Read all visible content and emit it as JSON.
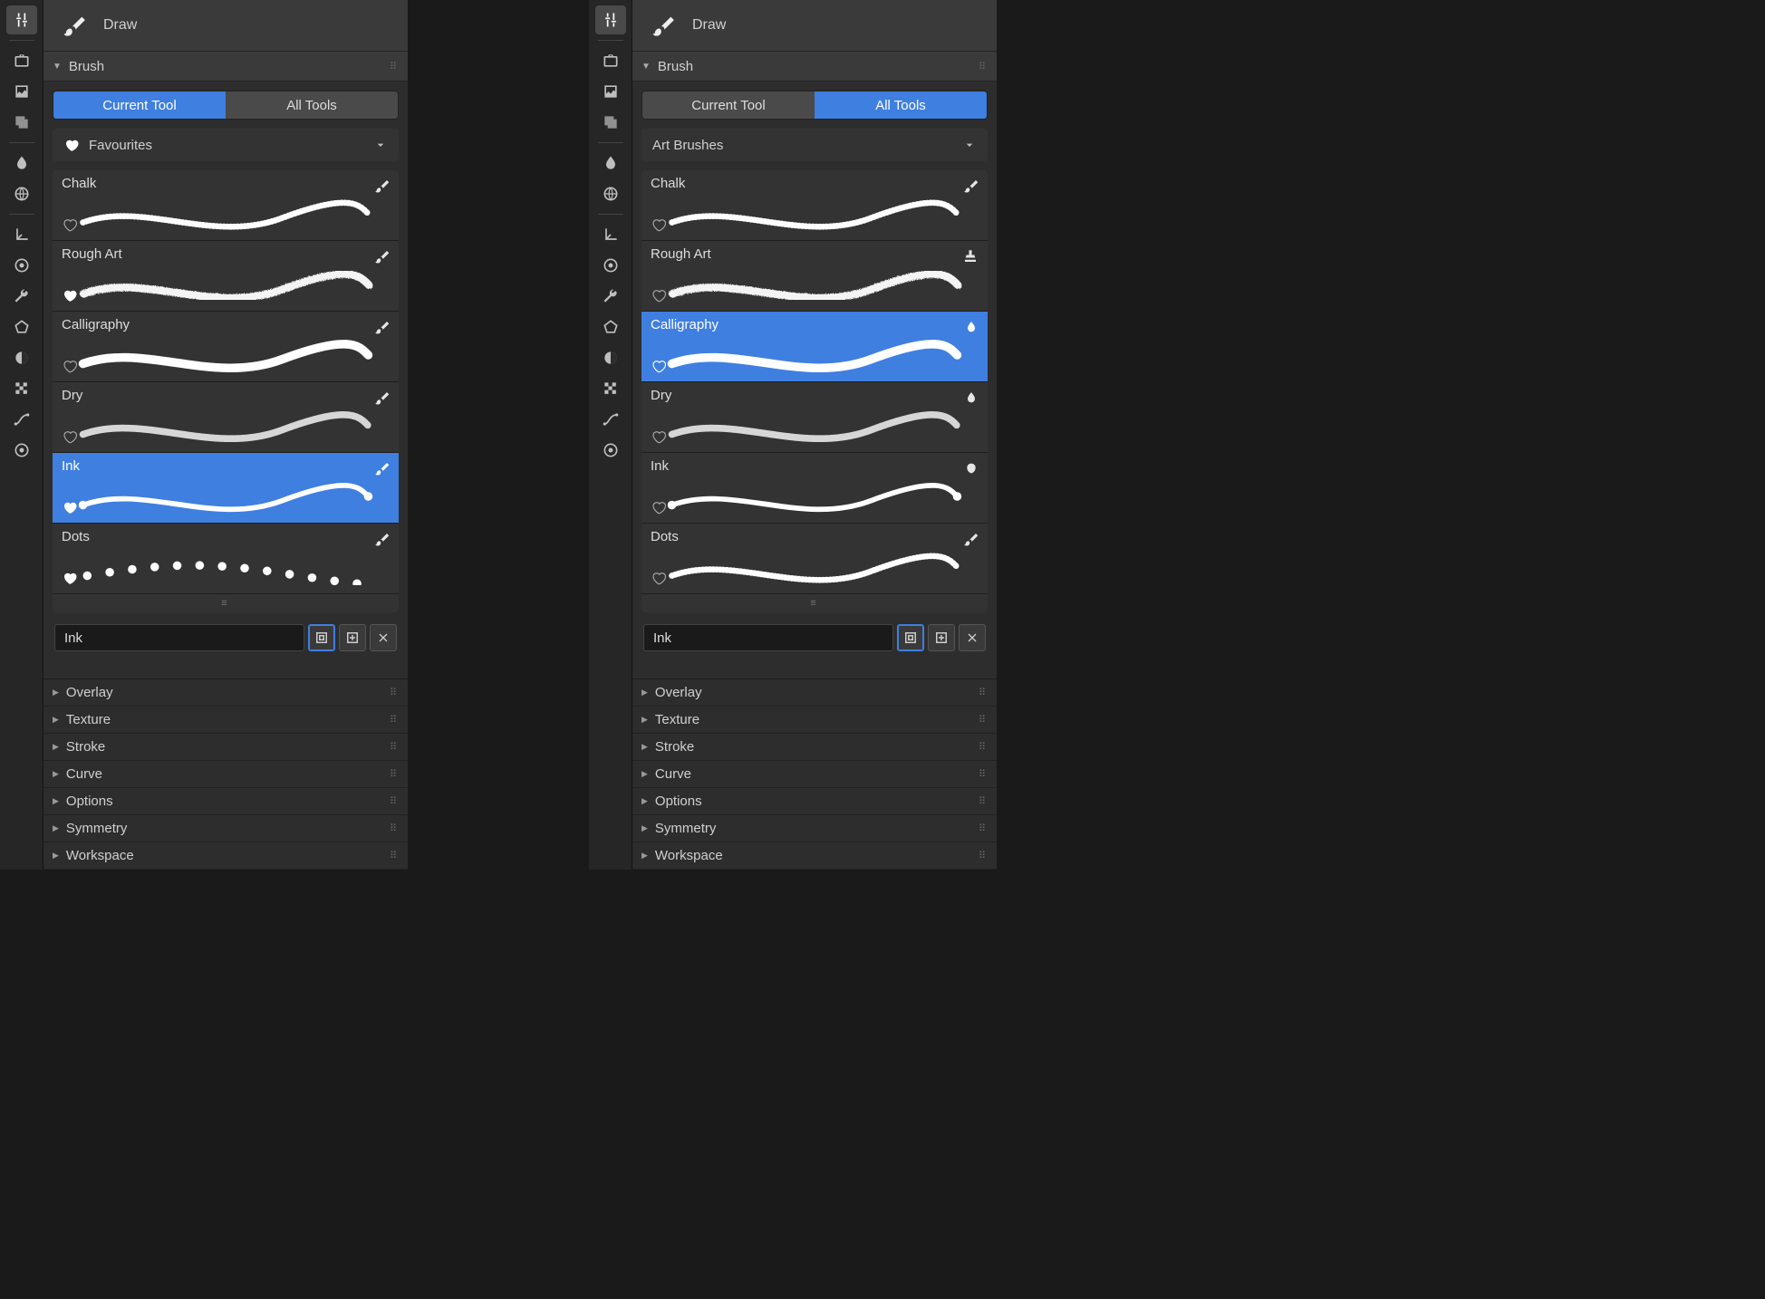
{
  "shared": {
    "header_tool": "Draw",
    "section_brush": "Brush",
    "tabs": {
      "current": "Current Tool",
      "all": "All Tools"
    },
    "name_input_value": "Ink",
    "sections": [
      "Overlay",
      "Texture",
      "Stroke",
      "Curve",
      "Options",
      "Symmetry",
      "Workspace"
    ],
    "brush_names": {
      "chalk": "Chalk",
      "rough": "Rough Art",
      "calli": "Calligraphy",
      "dry": "Dry",
      "ink": "Ink",
      "dots": "Dots"
    }
  },
  "left": {
    "tab_active": "current",
    "category_label": "Favourites",
    "show_heart_icon": true,
    "selected_brush": "ink",
    "brushes": [
      {
        "id": "chalk",
        "fav": false,
        "tip": "brush",
        "stroke": "chalk"
      },
      {
        "id": "rough",
        "fav": true,
        "tip": "brush",
        "stroke": "rough"
      },
      {
        "id": "calli",
        "fav": false,
        "tip": "brush",
        "stroke": "calli"
      },
      {
        "id": "dry",
        "fav": false,
        "tip": "brush",
        "stroke": "dry"
      },
      {
        "id": "ink",
        "fav": true,
        "tip": "brush",
        "stroke": "ink"
      },
      {
        "id": "dots",
        "fav": true,
        "tip": "brush",
        "stroke": "dots"
      }
    ]
  },
  "right": {
    "tab_active": "all",
    "category_label": "Art Brushes",
    "show_heart_icon": false,
    "selected_brush": "calli",
    "brushes": [
      {
        "id": "chalk",
        "fav": false,
        "tip": "brush",
        "stroke": "chalk"
      },
      {
        "id": "rough",
        "fav": false,
        "tip": "stamp",
        "stroke": "rough"
      },
      {
        "id": "calli",
        "fav": false,
        "tip": "drop",
        "stroke": "calli"
      },
      {
        "id": "dry",
        "fav": false,
        "tip": "drop",
        "stroke": "dry"
      },
      {
        "id": "ink",
        "fav": false,
        "tip": "blob",
        "stroke": "ink"
      },
      {
        "id": "dots",
        "fav": false,
        "tip": "brush",
        "stroke": "chalk"
      }
    ]
  }
}
